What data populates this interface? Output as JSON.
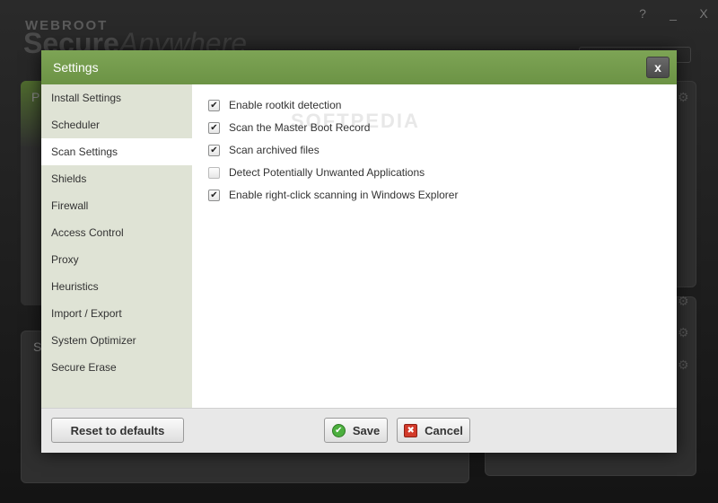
{
  "background": {
    "brand_top": "WEBROOT",
    "brand_main": "Secure",
    "brand_thin": "Anywhere",
    "window_controls": [
      "?",
      "_",
      "X"
    ],
    "panel_label_1": "P",
    "panel_label_2": "S"
  },
  "dialog": {
    "title": "Settings",
    "close_label": "x"
  },
  "sidebar": {
    "items": [
      {
        "label": "Install Settings"
      },
      {
        "label": "Scheduler"
      },
      {
        "label": "Scan Settings",
        "active": true
      },
      {
        "label": "Shields"
      },
      {
        "label": "Firewall"
      },
      {
        "label": "Access Control"
      },
      {
        "label": "Proxy"
      },
      {
        "label": "Heuristics"
      },
      {
        "label": "Import / Export"
      },
      {
        "label": "System Optimizer"
      },
      {
        "label": "Secure Erase"
      }
    ]
  },
  "scan_settings": {
    "options": [
      {
        "label": "Enable rootkit detection",
        "checked": true
      },
      {
        "label": "Scan the Master Boot Record",
        "checked": true
      },
      {
        "label": "Scan archived files",
        "checked": true
      },
      {
        "label": "Detect Potentially Unwanted Applications",
        "checked": false
      },
      {
        "label": "Enable right-click scanning in Windows Explorer",
        "checked": true
      }
    ]
  },
  "watermark": "SOFTPEDIA",
  "footer": {
    "reset_label": "Reset to defaults",
    "save_label": "Save",
    "cancel_label": "Cancel"
  },
  "icons": {
    "check": "checkmark-icon",
    "save": "save-check-icon",
    "cancel": "cancel-x-icon"
  },
  "colors": {
    "titlebar": "#7da455",
    "sidebar": "#dfe3d5",
    "save_icon": "#4caf3e",
    "cancel_icon": "#d23a2a"
  }
}
